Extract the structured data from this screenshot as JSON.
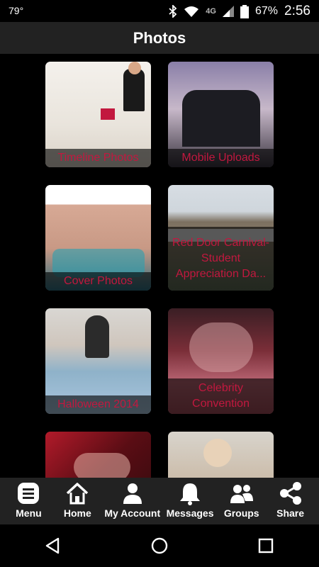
{
  "status_bar": {
    "temperature": "79°",
    "network": "4G",
    "battery": "67%",
    "time": "2:56"
  },
  "header": {
    "title": "Photos"
  },
  "albums": [
    {
      "label": "Timeline Photos"
    },
    {
      "label": "Mobile Uploads"
    },
    {
      "label": "Cover Photos"
    },
    {
      "label": "Red Door Carnival-Student Appreciation Da..."
    },
    {
      "label": "Halloween 2014"
    },
    {
      "label": "Celebrity Convention"
    },
    {
      "label": ""
    },
    {
      "label": ""
    }
  ],
  "bottom_nav": [
    {
      "label": "Menu",
      "icon": "menu-icon"
    },
    {
      "label": "Home",
      "icon": "home-icon"
    },
    {
      "label": "My Account",
      "icon": "user-icon"
    },
    {
      "label": "Messages",
      "icon": "bell-icon"
    },
    {
      "label": "Groups",
      "icon": "group-icon"
    },
    {
      "label": "Share",
      "icon": "share-icon"
    }
  ],
  "colors": {
    "accent": "#c2183f",
    "bar": "#222222",
    "background": "#000000"
  }
}
